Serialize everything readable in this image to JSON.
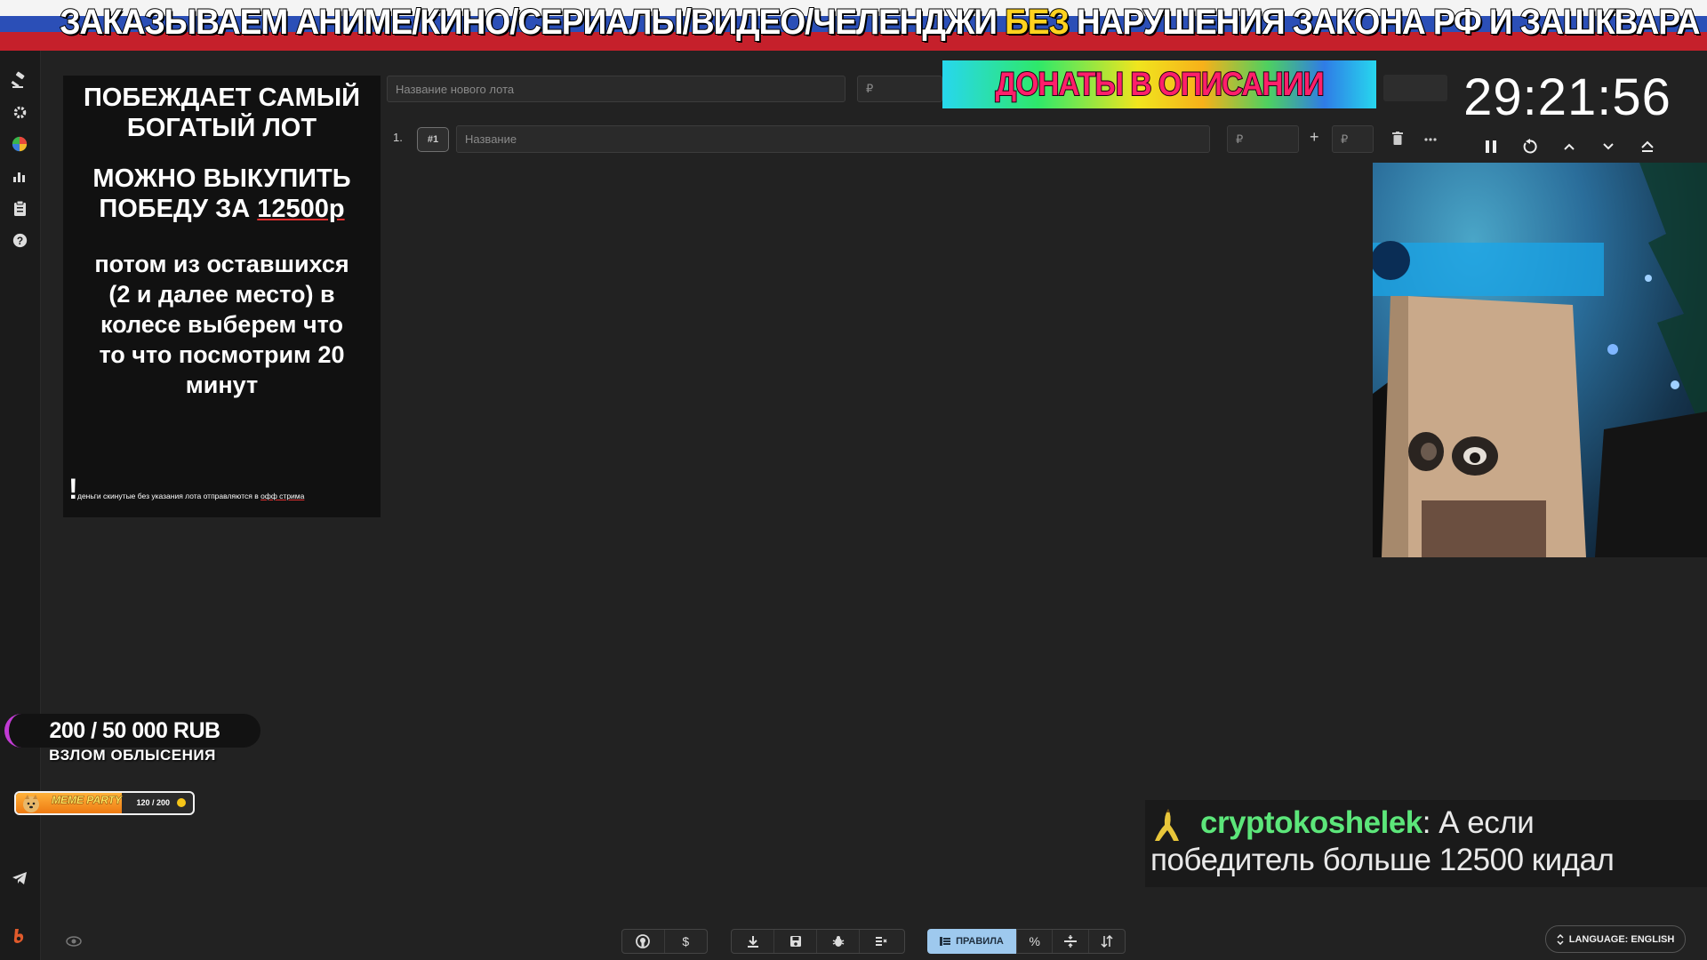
{
  "banner": {
    "text_before": "ЗАКАЗЫВАЕМ АНИМЕ/КИНО/СЕРИАЛЫ/ВИДЕО/ЧЕЛЕНДЖИ ",
    "text_highlight": "БЕЗ",
    "text_after": " НАРУШЕНИЯ ЗАКОНА РФ И ЗАШКВАРА ВСЯКОГО"
  },
  "sidebar": {
    "icons": [
      "gavel-icon",
      "gear-icon",
      "pie-chart-icon",
      "bar-chart-icon",
      "clipboard-icon",
      "help-icon",
      "telegram-icon",
      "brand-logo-icon",
      "eye-icon"
    ]
  },
  "rules_panel": {
    "line1": "ПОБЕЖДАЕТ САМЫЙ",
    "line2": "БОГАТЫЙ ЛОТ",
    "line3": "МОЖНО ВЫКУПИТЬ",
    "line4_prefix": "ПОБЕДУ ЗА ",
    "line4_price": "12500р",
    "line5": "потом из оставшихся",
    "line6": "(2 и далее место) в",
    "line7": "колесе выберем что",
    "line8": "то что посмотрим 20",
    "line9": "минут",
    "excl": "!",
    "note_prefix": "деньги скинутые без указания лота отправляются в ",
    "note_link": "офф стрима"
  },
  "new_lot": {
    "name_placeholder": "Название нового лота",
    "amount_placeholder": "₽"
  },
  "lots": [
    {
      "index": "1.",
      "badge": "#1",
      "name_placeholder": "Название",
      "amount_placeholder": "₽",
      "add_placeholder": "₽"
    }
  ],
  "donate_banner": "ДОНАТЫ В ОПИСАНИИ",
  "timer": {
    "value": "29:21:56",
    "controls": [
      "pause-icon",
      "reset-icon",
      "chevron-up-icon",
      "chevron-down-icon",
      "eject-icon"
    ]
  },
  "goal": {
    "amount": "200 / 50 000 RUB",
    "title": "ВЗЛОМ ОБЛЫСЕНИЯ"
  },
  "meme_party": {
    "label": "MEME PARTY",
    "count": "120 / 200",
    "progress": 0.6
  },
  "chat": {
    "user": "cryptokoshelek",
    "separator": ":",
    "message_part1": " А если",
    "message_part2": "победитель больше 12500 кидал"
  },
  "toolbar": {
    "rules_label": "ПРАВИЛА"
  },
  "language": {
    "label": "LANGUAGE: ENGLISH"
  },
  "colors": {
    "background": "#222222",
    "accent_blue": "#9ec9ee",
    "chat_user": "#5ce67a",
    "goal_accent": "#c23bd4",
    "banner_highlight": "#ffd21f"
  }
}
